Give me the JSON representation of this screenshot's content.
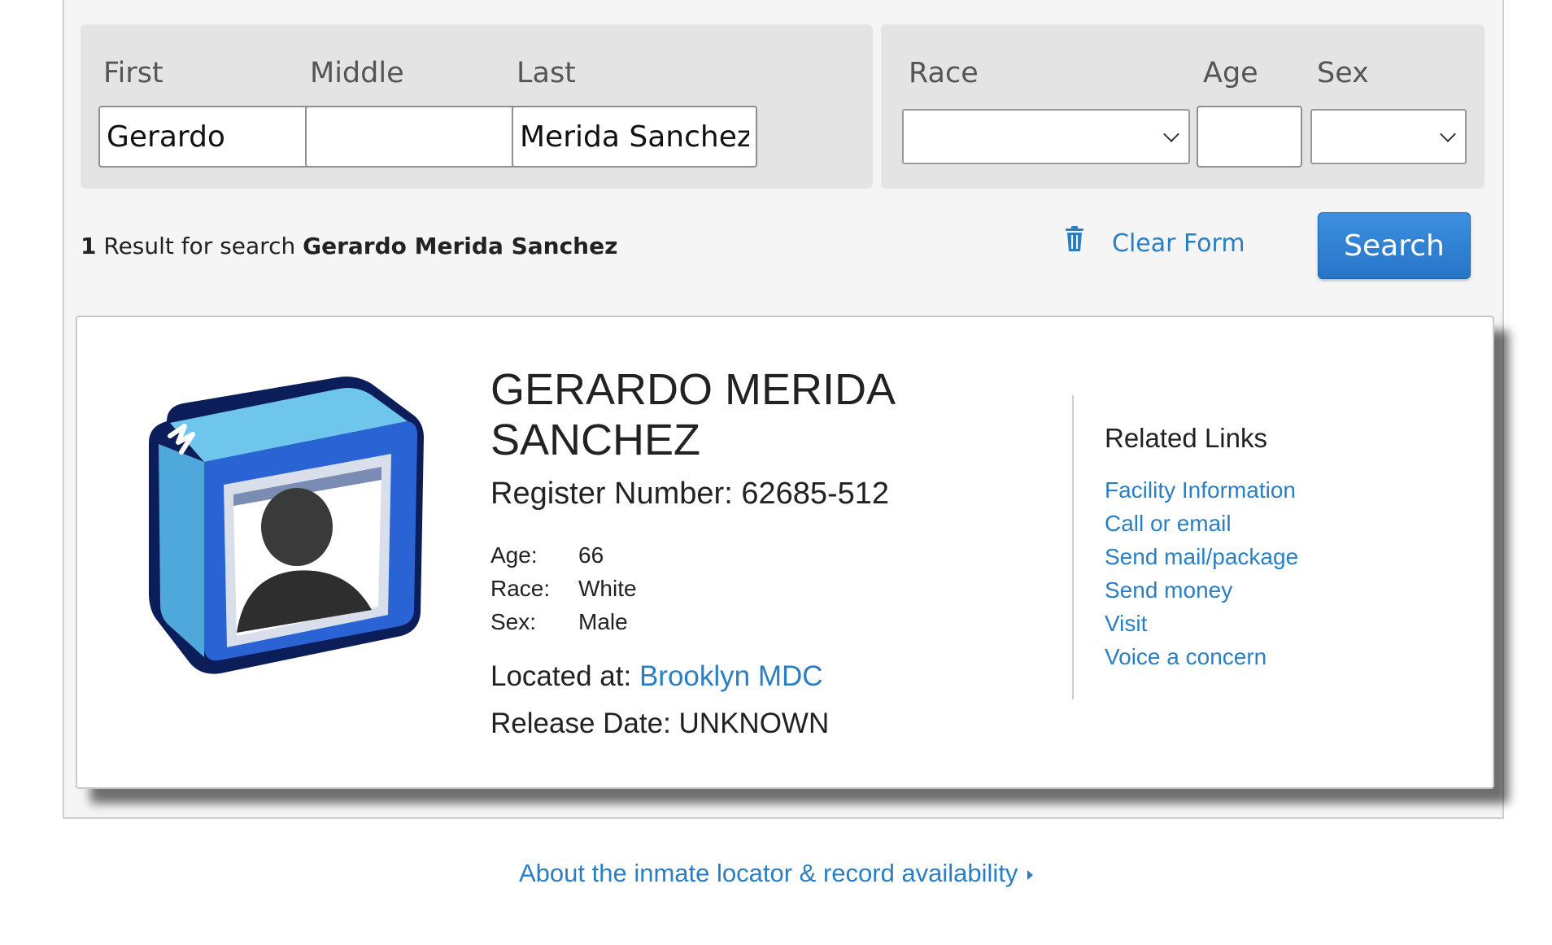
{
  "search_form": {
    "first": {
      "label": "First",
      "value": "Gerardo"
    },
    "middle": {
      "label": "Middle",
      "value": ""
    },
    "last": {
      "label": "Last",
      "value": "Merida Sanchez"
    },
    "race": {
      "label": "Race",
      "selected": ""
    },
    "age": {
      "label": "Age",
      "value": ""
    },
    "sex": {
      "label": "Sex",
      "selected": ""
    }
  },
  "results": {
    "count": "1",
    "text": " Result for search ",
    "query": "Gerardo Merida Sanchez"
  },
  "actions": {
    "clear_label": "Clear Form",
    "search_label": "Search"
  },
  "inmate": {
    "name_line1": "GERARDO MERIDA",
    "name_line2": "SANCHEZ",
    "register_label": "Register Number:",
    "register_number": "62685-512",
    "age_label": "Age:",
    "age": "66",
    "race_label": "Race:",
    "race": "White",
    "sex_label": "Sex:",
    "sex": "Male",
    "located_label": "Located at:",
    "facility": "Brooklyn MDC",
    "release_label": "Release Date:",
    "release_date": "UNKNOWN"
  },
  "related": {
    "title": "Related Links",
    "links": [
      "Facility Information",
      "Call or email",
      "Send mail/package",
      "Send money",
      "Visit",
      "Voice a concern"
    ]
  },
  "footer": {
    "about_label": "About the inmate locator & record availability"
  },
  "colors": {
    "link": "#2a7fc4",
    "search_button": "#2f80d4",
    "panel_bg": "#f5f5f5",
    "field_group_bg": "#e4e4e4"
  },
  "icons": [
    "trash-icon",
    "chevron-down-icon",
    "avatar-placeholder-icon",
    "caret-right-icon"
  ]
}
